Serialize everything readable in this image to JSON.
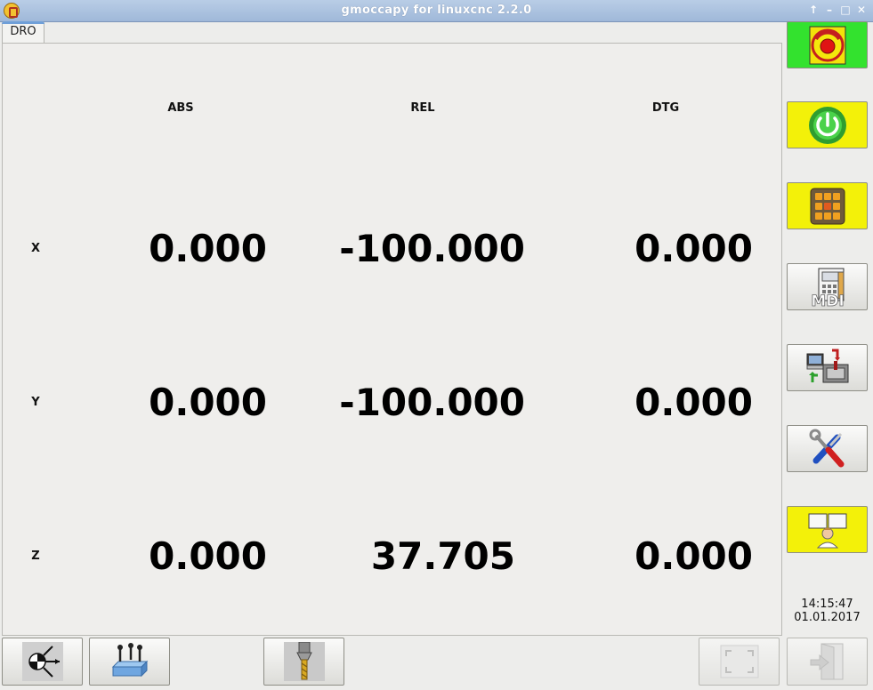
{
  "window": {
    "title": "gmoccapy for linuxcnc  2.2.0",
    "controls": [
      "↑",
      "–",
      "□",
      "✕"
    ]
  },
  "tabs": [
    {
      "label": "DRO"
    }
  ],
  "dro": {
    "columns": [
      "ABS",
      "REL",
      "DTG"
    ],
    "rows": [
      {
        "axis": "X",
        "abs": "0.000",
        "rel": "-100.000",
        "dtg": "0.000"
      },
      {
        "axis": "Y",
        "abs": "0.000",
        "rel": "-100.000",
        "dtg": "0.000"
      },
      {
        "axis": "Z",
        "abs": "0.000",
        "rel": "37.705",
        "dtg": "0.000"
      }
    ]
  },
  "sidebar": {
    "buttons": [
      {
        "name": "emergency-stop-button",
        "icon": "emergency-stop-icon",
        "icon_text": "Emergency-Stop",
        "bg": "#33e22e"
      },
      {
        "name": "machine-power-button",
        "icon": "power-icon",
        "bg": "#f3f109"
      },
      {
        "name": "manual-mode-button",
        "icon": "jog-arrows-icon",
        "bg": "#f3f109"
      },
      {
        "name": "mdi-mode-button",
        "icon": "mdi-icon",
        "icon_text": "MDI",
        "bg": "#fbfbfa"
      },
      {
        "name": "auto-mode-button",
        "icon": "machine-auto-icon",
        "bg": "#fbfbfa"
      },
      {
        "name": "settings-button",
        "icon": "tools-icon",
        "bg": "#fbfbfa"
      },
      {
        "name": "user-tabs-button",
        "icon": "user-icon",
        "bg": "#f3f109"
      }
    ]
  },
  "clock": {
    "time": "14:15:47",
    "date": "01.01.2017"
  },
  "bottom": {
    "buttons": [
      {
        "name": "touch-off-button",
        "icon": "coordinate-origin-icon"
      },
      {
        "name": "ref-all-button",
        "icon": "work-piece-icon"
      },
      {
        "name": "tool-button",
        "icon": "drill-icon"
      },
      {
        "name": "fullscreen-button",
        "icon": "fullscreen-icon",
        "disabled": true
      },
      {
        "name": "exit-button",
        "icon": "exit-door-icon",
        "disabled": true
      }
    ]
  }
}
